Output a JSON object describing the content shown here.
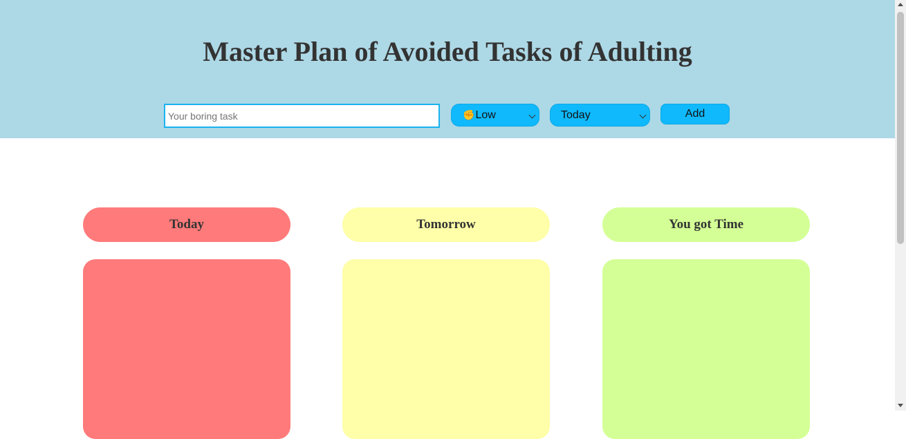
{
  "header": {
    "title": "Master Plan of Avoided Tasks of Adulting",
    "background_color": "#add8e6"
  },
  "form": {
    "task_placeholder": "Your boring task",
    "task_value": "",
    "priority_emoji": "✊",
    "priority_label": "Low",
    "due_selected": "Today",
    "add_label": "Add",
    "control_color": "#0fb9fc"
  },
  "columns": [
    {
      "title": "Today",
      "color": "#ff7a7a"
    },
    {
      "title": "Tomorrow",
      "color": "#feffa8"
    },
    {
      "title": "You got Time",
      "color": "#d4ff96"
    }
  ]
}
